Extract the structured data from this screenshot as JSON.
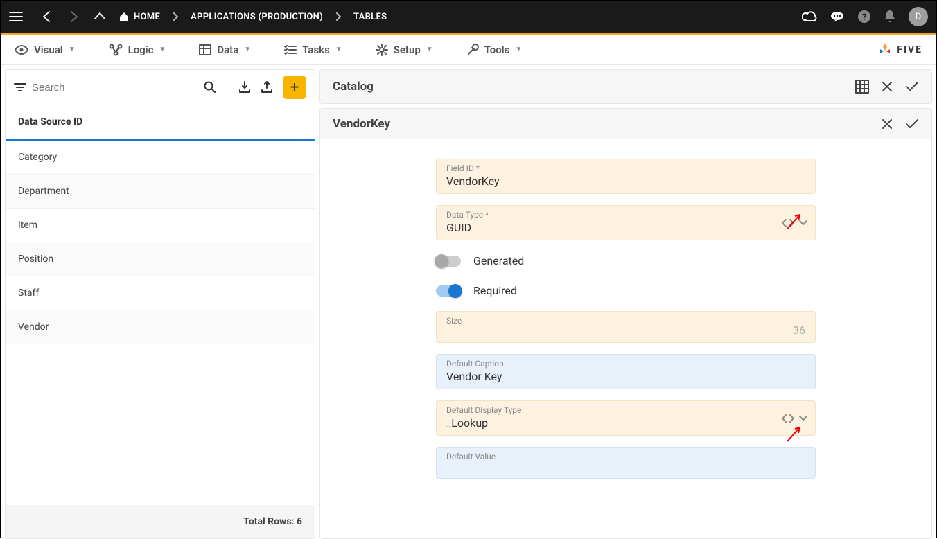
{
  "topbar": {
    "breadcrumb": [
      "HOME",
      "APPLICATIONS (PRODUCTION)",
      "TABLES"
    ],
    "avatar_initial": "D"
  },
  "menubar": {
    "items": [
      {
        "label": "Visual"
      },
      {
        "label": "Logic"
      },
      {
        "label": "Data"
      },
      {
        "label": "Tasks"
      },
      {
        "label": "Setup"
      },
      {
        "label": "Tools"
      }
    ],
    "brand": "FIVE"
  },
  "sidebar": {
    "search_placeholder": "Search",
    "header": "Data Source ID",
    "items": [
      {
        "label": "Category"
      },
      {
        "label": "Department"
      },
      {
        "label": "Item"
      },
      {
        "label": "Position"
      },
      {
        "label": "Staff"
      },
      {
        "label": "Vendor"
      }
    ],
    "footer_label": "Total Rows:",
    "footer_count": "6"
  },
  "catalog": {
    "title": "Catalog"
  },
  "detail": {
    "title": "VendorKey",
    "fields": {
      "field_id_label": "Field ID *",
      "field_id_value": "VendorKey",
      "data_type_label": "Data Type *",
      "data_type_value": "GUID",
      "generated_label": "Generated",
      "required_label": "Required",
      "size_label": "Size",
      "size_value": "36",
      "default_caption_label": "Default Caption",
      "default_caption_value": "Vendor Key",
      "default_display_type_label": "Default Display Type",
      "default_display_type_value": "_Lookup",
      "default_value_label": "Default Value"
    }
  }
}
